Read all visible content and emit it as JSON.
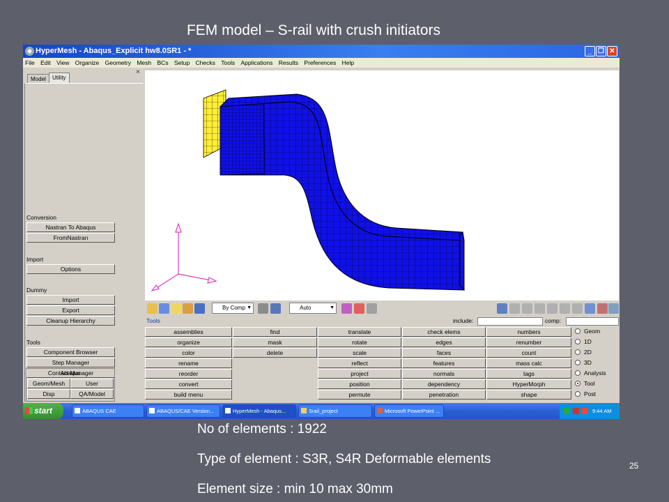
{
  "slide": {
    "title": "FEM model – S-rail with crush initiators",
    "number": "25",
    "bullets": [
      "No of elements : 1922",
      "Type of element : S3R, S4R Deformable elements",
      "Element size : min 10 max 30mm"
    ]
  },
  "window": {
    "title": "HyperMesh - Abaqus_Explicit hw8.0SR1 - *",
    "min_label": "_",
    "max_label": "❐",
    "close_label": "✕"
  },
  "menu": [
    "File",
    "Edit",
    "View",
    "Organize",
    "Geometry",
    "Mesh",
    "BCs",
    "Setup",
    "Checks",
    "Tools",
    "Applications",
    "Results",
    "Preferences",
    "Help"
  ],
  "left_panel": {
    "close_label": "×",
    "tabs": [
      "Model",
      "Utility"
    ],
    "conversion": {
      "heading": "Conversion",
      "buttons": [
        "Nastran To Abaqus",
        "FromNastran"
      ]
    },
    "import": {
      "heading": "Import",
      "buttons": [
        "Options"
      ]
    },
    "dummy": {
      "heading": "Dummy",
      "buttons": [
        "Import",
        "Export",
        "Cleanup Hierarchy"
      ]
    },
    "tools": {
      "heading": "Tools",
      "buttons": [
        "Component Browser",
        "Step Manager",
        "Contact Manager"
      ]
    },
    "abaqus": {
      "heading": "Abaqus",
      "cells": [
        "Geom/Mesh",
        "User",
        "Disp",
        "QA/Model"
      ]
    }
  },
  "toolbar": {
    "color_mode": "By Comp",
    "display_mode": "Auto"
  },
  "tools_bar": {
    "label": "Tools",
    "include_label": "include:",
    "comp_label": "comp:"
  },
  "tool_grid": {
    "col1": [
      "assemblies",
      "organize",
      "color",
      "rename",
      "reorder",
      "convert",
      "build menu"
    ],
    "col2": [
      "find",
      "mask",
      "delete"
    ],
    "col3": [
      "translate",
      "rotate",
      "scale",
      "reflect",
      "project",
      "position",
      "permute"
    ],
    "col4": [
      "check elems",
      "edges",
      "faces",
      "features",
      "normals",
      "dependency",
      "penetration"
    ],
    "col5": [
      "numbers",
      "renumber",
      "count",
      "mass calc",
      "tags",
      "HyperMorph",
      "shape"
    ]
  },
  "radio_group": {
    "options": [
      "Geom",
      "1D",
      "2D",
      "3D",
      "Analysis",
      "Tool",
      "Post"
    ],
    "selected": "Tool"
  },
  "taskbar": {
    "start": "start",
    "buttons": [
      "ABAQUS CAE",
      "ABAQUS/CAE Version...",
      "HyperMesh - Abaqus...",
      "Srail_project",
      "Microsoft PowerPoint ..."
    ],
    "active": "HyperMesh - Abaqus...",
    "clock": "9:44 AM"
  },
  "colors": {
    "mesh": "#1010e8",
    "mesh_lines": "#000000",
    "rigid_wall": "#ffee33",
    "triad": "#e040c0"
  }
}
